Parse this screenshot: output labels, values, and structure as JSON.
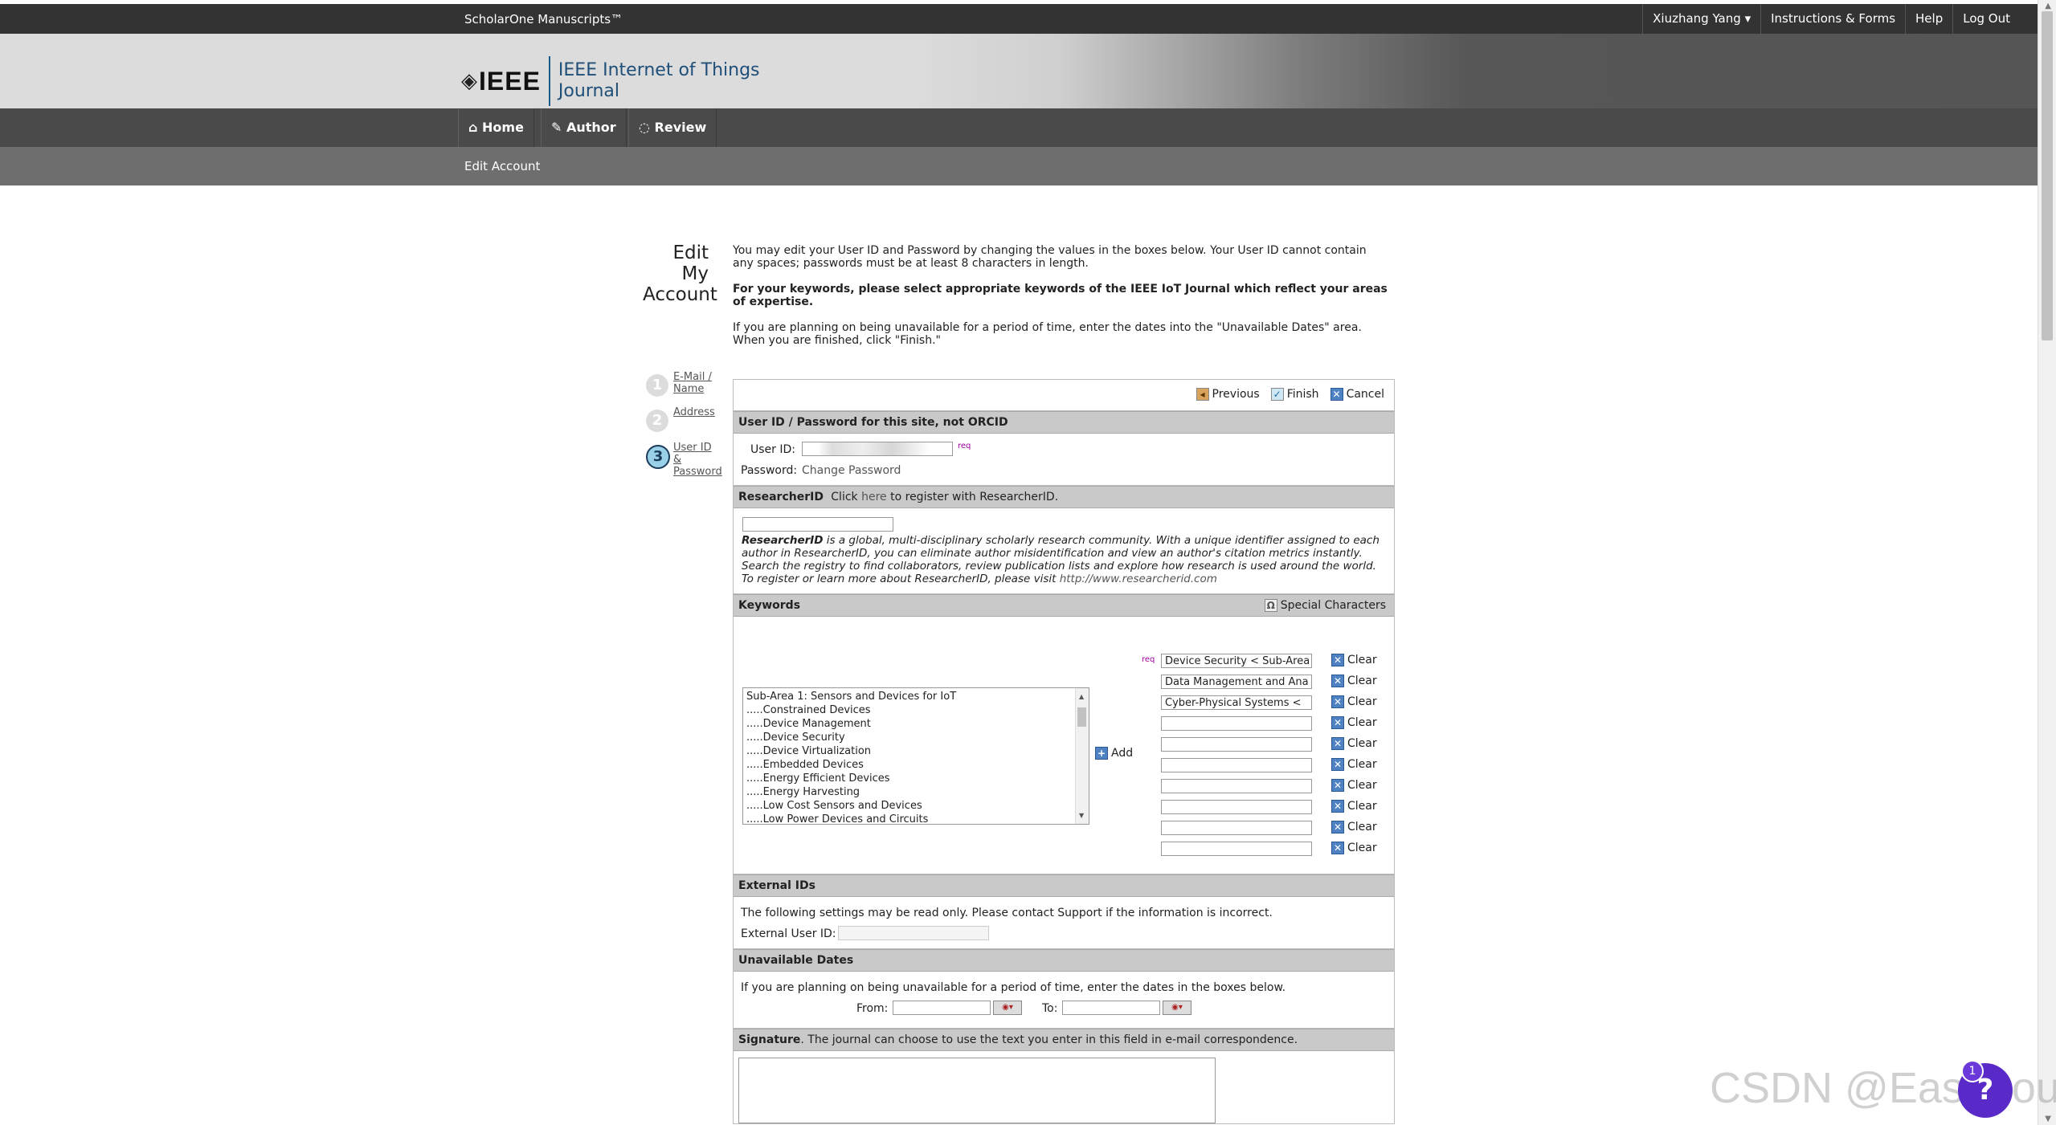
{
  "topbar": {
    "brand": "ScholarOne Manuscripts™",
    "user_menu": "Xiuzhang Yang",
    "links": [
      "Instructions & Forms",
      "Help",
      "Log Out"
    ]
  },
  "banner": {
    "logo_text": "IEEE",
    "journal_line1": "IEEE Internet of Things",
    "journal_line2": "Journal"
  },
  "nav": {
    "home": "Home",
    "author": "Author",
    "review": "Review"
  },
  "subnav": {
    "edit_account": "Edit Account"
  },
  "page": {
    "title_line1": "Edit My",
    "title_line2": "Account",
    "intro_1": "You may edit your User ID and Password by changing the values in the boxes below. Your User ID cannot contain any spaces; passwords must be at least 8 characters in length.",
    "intro_2": "For your keywords, please select appropriate keywords of the IEEE IoT Journal which reflect your areas of expertise.",
    "intro_3": "If you are planning on being unavailable for a period of time, enter the dates into the \"Unavailable Dates\" area. When you are finished, click \"Finish.\""
  },
  "steps": [
    {
      "num": "1",
      "label_a": "E-Mail /",
      "label_b": "Name",
      "label_c": ""
    },
    {
      "num": "2",
      "label_a": "Address",
      "label_b": "",
      "label_c": ""
    },
    {
      "num": "3",
      "label_a": "User ID",
      "label_b": "&",
      "label_c": "Password"
    }
  ],
  "buttons": {
    "previous": "Previous",
    "finish": "Finish",
    "cancel": "Cancel"
  },
  "userid_section": {
    "heading": "User ID / Password for this site, not ORCID",
    "userid_label": "User ID:",
    "req": "req",
    "password_label": "Password:",
    "change_password": "Change Password"
  },
  "researcher": {
    "heading": "ResearcherID",
    "click": "Click",
    "here": "here",
    "rest": "to register with ResearcherID.",
    "desc_bold": "ResearcherID",
    "desc": " is a global, multi-disciplinary scholarly research community. With a unique identifier assigned to each author in ResearcherID, you can eliminate author misidentification and view an author's citation metrics instantly. Search the registry to find collaborators, review publication lists and explore how research is used around the world. To register or learn more about ResearcherID, please visit ",
    "link": "http://www.researcherid.com"
  },
  "keywords": {
    "heading": "Keywords",
    "special_chars": "Special Characters",
    "list": [
      "Sub-Area 1: Sensors and Devices for IoT",
      ".....Constrained Devices",
      ".....Device Management",
      ".....Device Security",
      ".....Device Virtualization",
      ".....Embedded Devices",
      ".....Energy Efficient Devices",
      ".....Energy Harvesting",
      ".....Low Cost Sensors and Devices",
      ".....Low Power Devices and Circuits"
    ],
    "add": "Add",
    "req": "req",
    "clear": "Clear",
    "selected": [
      "Device Security < Sub-Area",
      "Data Management and Ana",
      "Cyber-Physical Systems <",
      "",
      "",
      "",
      "",
      "",
      "",
      ""
    ]
  },
  "external": {
    "heading": "External IDs",
    "note": "The following settings may be read only. Please contact Support if the information is incorrect.",
    "label": "External User ID:"
  },
  "unavailable": {
    "heading": "Unavailable Dates",
    "note": "If you are planning on being unavailable for a period of time, enter the dates in the boxes below.",
    "from": "From:",
    "to": "To:"
  },
  "signature": {
    "heading": "Signature",
    "note": ". The journal can choose to use the text you enter in this field in e-mail correspondence."
  },
  "overlay": {
    "watermark": "CSDN @Eastmount",
    "help_badge": "1",
    "help_icon": "?"
  }
}
